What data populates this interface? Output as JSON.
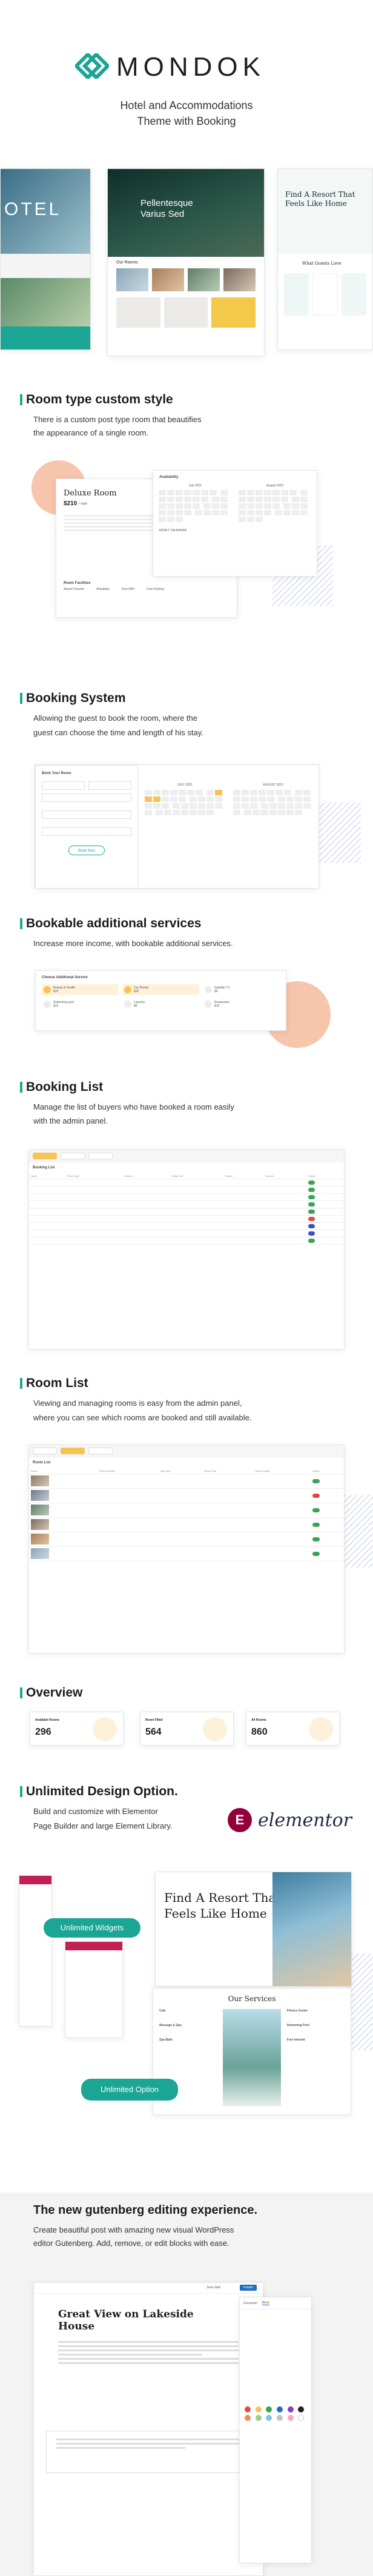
{
  "brand": {
    "name": "MONDOK",
    "tagline_1": "Hotel and Accommodations",
    "tagline_2": "Theme with Booking",
    "color": "#1aa594"
  },
  "hero_screens": {
    "left_label": "OTEL",
    "center_title_1": "Pellentesque",
    "center_title_2": "Varius Sed",
    "center_section": "Our Rooms",
    "right_title_1": "Find A Resort That",
    "right_title_2": "Feels Like Home",
    "right_section": "What Guests Love"
  },
  "section_room_type": {
    "title": "Room type custom style",
    "desc_1": "There is a custom post type room that beautifies",
    "desc_2": "the appearance of a single room.",
    "room_title": "Deluxe Room",
    "price": "$210",
    "price_unit": "/ night",
    "facilities_title": "Room Facilities",
    "facilities": [
      "Airport Transfer",
      "Breakfast",
      "Free WiFi",
      "Free Parking"
    ],
    "availability_title": "Availability",
    "month_1": "July 2023",
    "month_2": "August 2023",
    "cal_footer": "RESET CALENDAR"
  },
  "section_booking": {
    "title": "Booking System",
    "desc_1": "Allowing the guest to book the room, where the",
    "desc_2": "guest can choose the time and length of his stay.",
    "form_title": "Book Your Room",
    "book_button": "Book Now",
    "month_1": "JULY 2023",
    "month_2": "AUGUST 2023"
  },
  "section_services": {
    "title": "Bookable additional services",
    "desc": "Increase more income, with bookable additional services.",
    "card_title": "Choose Additional Service",
    "items": [
      {
        "name": "Beauty & Health",
        "price": "$15"
      },
      {
        "name": "Car Rental",
        "price": "$20"
      },
      {
        "name": "Satellite TV",
        "price": "$5"
      },
      {
        "name": "Swimming pool",
        "price": "$12"
      },
      {
        "name": "Laundry",
        "price": "$8"
      },
      {
        "name": "Restaurant",
        "price": "$10"
      }
    ]
  },
  "section_booking_list": {
    "title": "Booking List",
    "desc_1": "Manage the list of buyers who have booked a room easily",
    "desc_2": "with the admin panel.",
    "panel_title": "Booking List",
    "columns": [
      "Name",
      "Room Type",
      "Check In",
      "Check Out",
      "Guests",
      "Amount",
      "Status"
    ]
  },
  "section_room_list": {
    "title": "Room List",
    "desc_1": "Viewing and managing rooms is easy from the admin panel,",
    "desc_2": "where you can see which rooms are booked and still available.",
    "panel_title": "Room List",
    "columns": [
      "Room",
      "Room Number",
      "Bed Type",
      "Room Floor",
      "Room Facility",
      "Status"
    ]
  },
  "section_overview": {
    "title": "Overview",
    "stats": [
      {
        "label": "Available Rooms",
        "value": "296"
      },
      {
        "label": "Room Filled",
        "value": "564"
      },
      {
        "label": "All Rooms",
        "value": "860"
      }
    ]
  },
  "section_design": {
    "title": "Unlimited Design Option.",
    "desc_1": "Build and customize with Elementor",
    "desc_2": "Page Builder and large Element Library.",
    "elementor_logo": "elementor",
    "elementor_mark": "E",
    "widgets_badge": "Unlimited Widgets",
    "options_badge": "Unlimited Option",
    "site_title_1": "Find A Resort That",
    "site_title_2": "Feels Like Home",
    "services_title": "Our Services",
    "services": [
      "Cafe",
      "Massage & Spa",
      "Spa Bath",
      "Fitness Center",
      "Swimming Pool",
      "Free Internet"
    ]
  },
  "section_gutenberg": {
    "title": "The new gutenberg editing experience.",
    "desc_1": "Create beautiful post with amazing new visual WordPress",
    "desc_2": "editor Gutenberg. Add, remove, or edit blocks with ease.",
    "post_title_1": "Great View on Lakeside",
    "post_title_2": "House",
    "save_label": "Save draft",
    "publish_label": "Publish",
    "sidebar_tab_1": "Document",
    "sidebar_tab_2": "Block"
  }
}
